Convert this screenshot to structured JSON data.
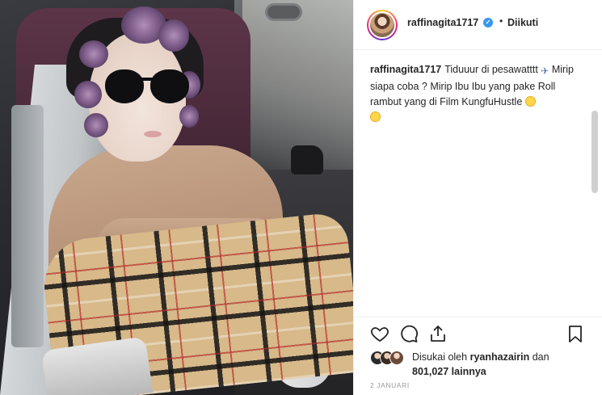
{
  "post": {
    "username": "raffinagita1717",
    "follow_status": "Diikuti",
    "separator": "•",
    "caption_username": "raffinagita1717",
    "caption_text_1": "Tiduuur di pesawatttt",
    "caption_text_2": "Mirip siapa coba ? Mirip Ibu Ibu yang pake Roll rambut yang di Film KungfuHustle",
    "likes_prefix": "Disukai oleh",
    "liked_by_user": "ryanhazairin",
    "likes_connector": "dan",
    "likes_count": "801,027",
    "likes_suffix": "lainnya",
    "date": "2 JANUARI"
  },
  "icons": {
    "verified": "verified-badge-icon",
    "plane_emoji": "airplane-emoji-icon",
    "grin_emoji": "grin-emoji-icon",
    "laugh_emoji": "rolling-laugh-emoji-icon",
    "like": "heart-icon",
    "comment": "comment-bubble-icon",
    "share": "share-arrow-icon",
    "save": "bookmark-icon"
  },
  "colors": {
    "verified": "#3897f0",
    "text": "#262626",
    "muted": "#999999",
    "border": "#efefef"
  }
}
